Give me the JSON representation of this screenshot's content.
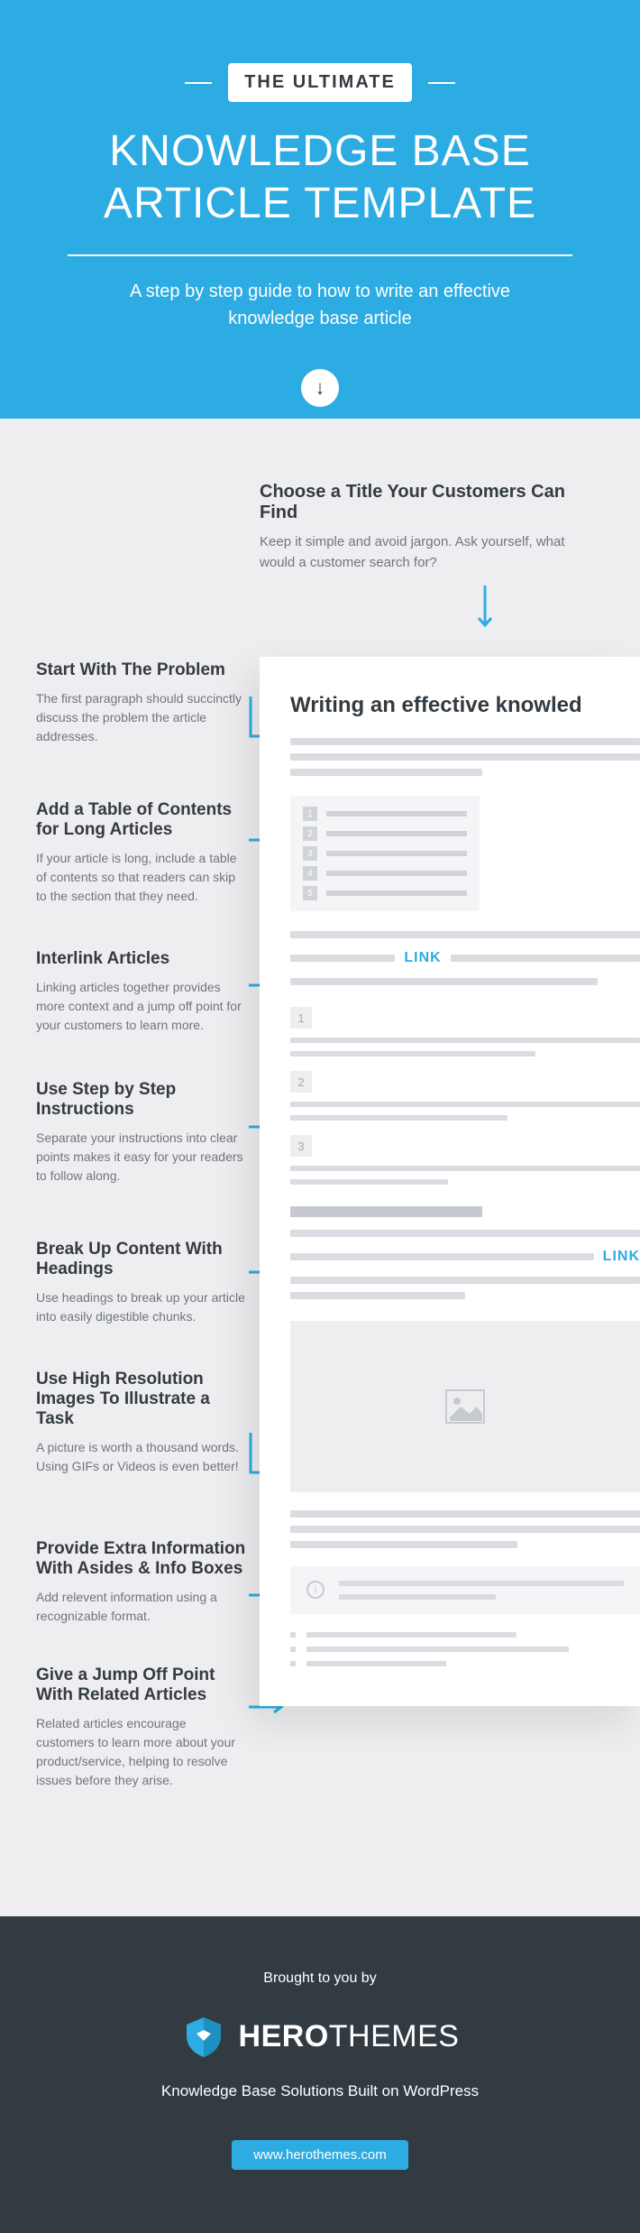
{
  "header": {
    "badge": "THE ULTIMATE",
    "title_line1": "KNOWLEDGE BASE",
    "title_line2": "ARTICLE TEMPLATE",
    "subtitle": "A step by step guide to how to write an effective knowledge base article"
  },
  "steps": [
    {
      "title": "Choose a Title Your Customers Can Find",
      "desc": "Keep it simple and avoid jargon. Ask yourself, what would a customer search for?"
    },
    {
      "title": "Start With The Problem",
      "desc": "The first paragraph should succinctly discuss the problem the article addresses."
    },
    {
      "title": "Add a Table of Contents for Long Articles",
      "desc": "If your article is long, include a table of contents so that readers can skip to the section that they need."
    },
    {
      "title": "Interlink Articles",
      "desc": "Linking articles together provides more context and a jump off point for your customers to learn more."
    },
    {
      "title": "Use Step by Step Instructions",
      "desc": "Separate your instructions into clear points makes it easy for your readers to follow along."
    },
    {
      "title": "Break Up Content With Headings",
      "desc": "Use headings to break up your article into easily digestible chunks."
    },
    {
      "title": "Use High Resolution Images To Illustrate a Task",
      "desc": "A picture is worth a thousand words. Using GIFs or Videos is even better!"
    },
    {
      "title": "Provide Extra Information With Asides & Info Boxes",
      "desc": "Add relevent information using a recognizable format."
    },
    {
      "title": "Give a Jump Off Point With Related Articles",
      "desc": "Related articles encourage customers to learn more about your product/service, helping to resolve issues before they arise."
    }
  ],
  "mockup": {
    "title": "Writing an effective knowled",
    "link": "LINK",
    "toc_nums": [
      "1",
      "2",
      "3",
      "4",
      "5"
    ],
    "step_nums": [
      "1",
      "2",
      "3"
    ]
  },
  "footer": {
    "brought": "Brought to you by",
    "logo_brand": "HERO",
    "logo_brand2": "THEMES",
    "tagline": "Knowledge Base Solutions Built on WordPress",
    "url": "www.herothemes.com"
  }
}
